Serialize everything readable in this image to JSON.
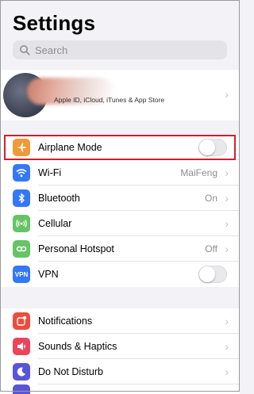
{
  "header": {
    "title": "Settings"
  },
  "search": {
    "placeholder": "Search"
  },
  "profile": {
    "subtitle": "Apple ID, iCloud, iTunes & App Store"
  },
  "network_group": [
    {
      "label": "Airplane Mode",
      "icon": "airplane-icon",
      "color": "#f09a37",
      "toggle": false
    },
    {
      "label": "Wi-Fi",
      "icon": "wifi-icon",
      "color": "#3478f6",
      "value": "MaiFeng"
    },
    {
      "label": "Bluetooth",
      "icon": "bluetooth-icon",
      "color": "#3478f6",
      "value": "On"
    },
    {
      "label": "Cellular",
      "icon": "cellular-icon",
      "color": "#65c466"
    },
    {
      "label": "Personal Hotspot",
      "icon": "hotspot-icon",
      "color": "#65c466",
      "value": "Off"
    },
    {
      "label": "VPN",
      "icon": "vpn-icon",
      "color": "#3478f6",
      "toggle": false
    }
  ],
  "notifications_group": [
    {
      "label": "Notifications",
      "icon": "notifications-icon",
      "color": "#eb4d3d"
    },
    {
      "label": "Sounds & Haptics",
      "icon": "sounds-icon",
      "color": "#eb445a"
    },
    {
      "label": "Do Not Disturb",
      "icon": "do-not-disturb-icon",
      "color": "#5856d6"
    }
  ],
  "colors": {
    "highlight": "#d0202c",
    "background": "#f2f2f7"
  }
}
